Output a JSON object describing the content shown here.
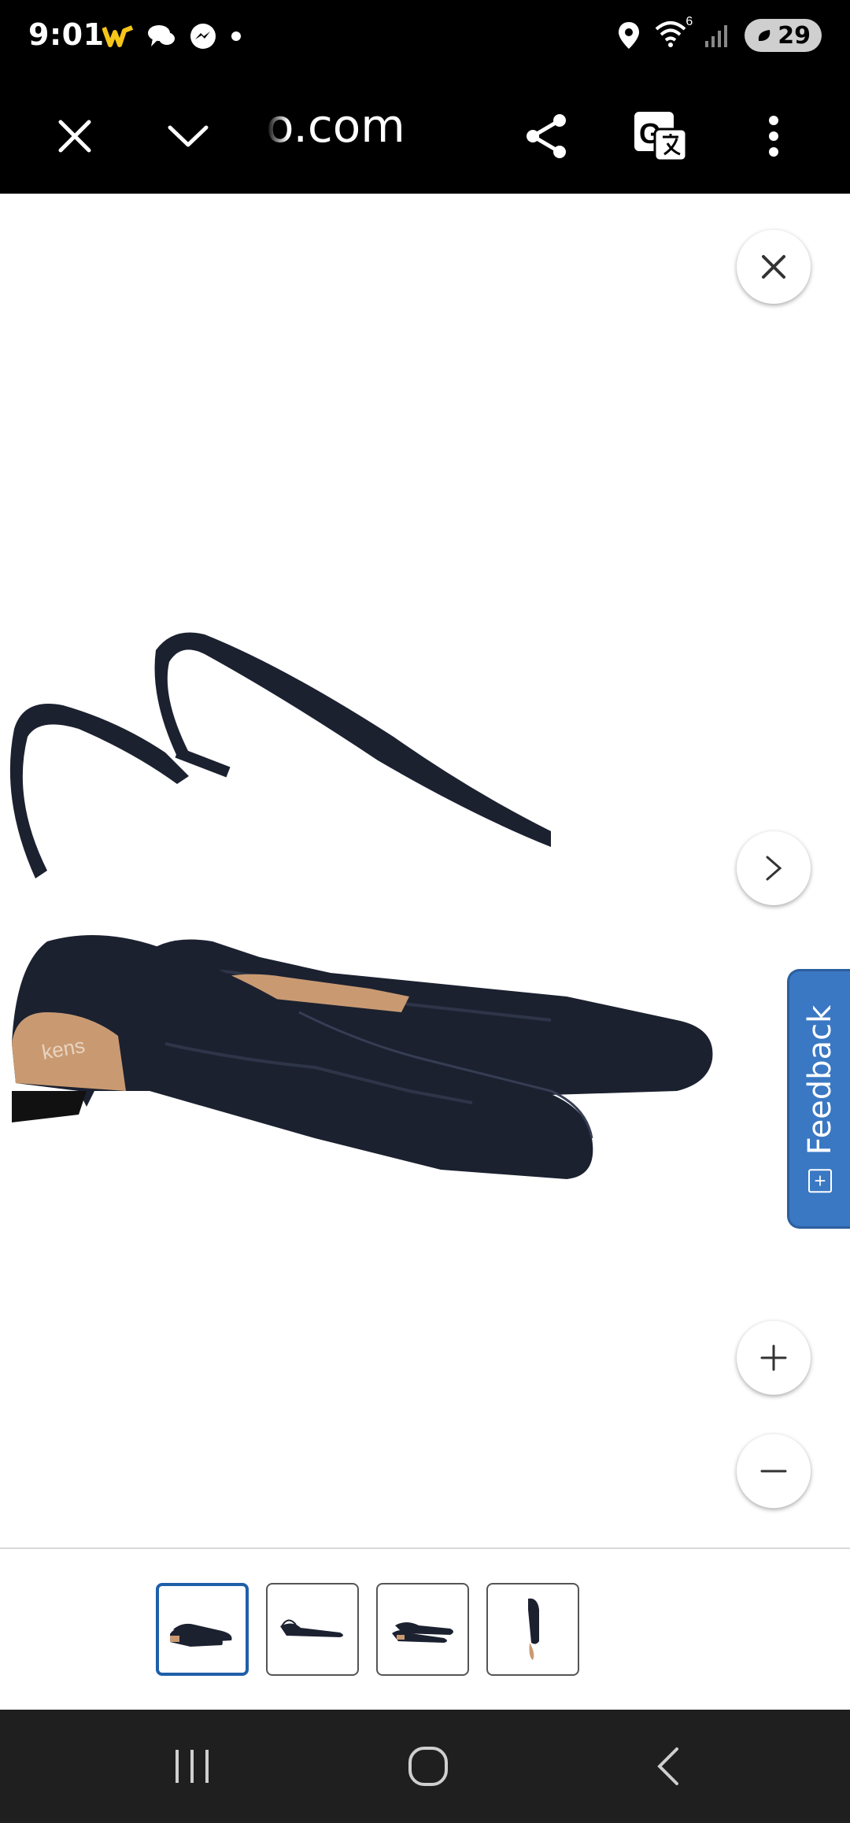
{
  "status_bar": {
    "time": "9:01",
    "battery": "29",
    "left_icons": [
      "webtoon-icon",
      "chat-icon",
      "messenger-icon",
      "dot-icon"
    ],
    "right_icons": [
      "location-icon",
      "wifi-icon",
      "signal-icon",
      "battery-icon"
    ],
    "wifi_label": "6"
  },
  "toolbar": {
    "url": "o.com",
    "icons": [
      "close-icon",
      "chevron-down-icon",
      "share-icon",
      "translate-icon",
      "more-vert-icon"
    ]
  },
  "viewer": {
    "product": "black slingback flat shoes",
    "insole_brand": "kens",
    "feedback_label": "Feedback",
    "feedback_glyph": "+",
    "zoom_buttons": [
      "zoom-in",
      "zoom-out"
    ]
  },
  "thumbnails": [
    {
      "view": "pair-angle",
      "selected": true
    },
    {
      "view": "side",
      "selected": false
    },
    {
      "view": "pair-side",
      "selected": false
    },
    {
      "view": "top",
      "selected": false
    }
  ],
  "colors": {
    "accent": "#1f5fa8",
    "feedback_bg": "#3a78c3",
    "shoe": "#1c2130",
    "insole": "#c99a72"
  }
}
